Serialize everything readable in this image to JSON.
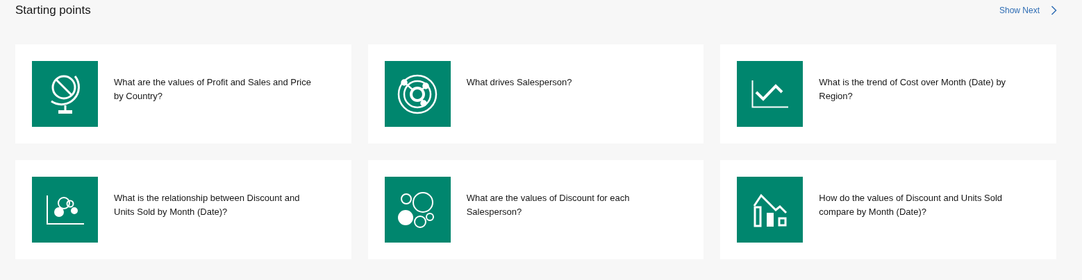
{
  "header": {
    "title": "Starting points",
    "show_next": "Show Next"
  },
  "cards": [
    {
      "kind": "globe",
      "question": "What are the values of Profit and Sales and Price by Country?"
    },
    {
      "kind": "network",
      "question": "What drives Salesperson?"
    },
    {
      "kind": "line",
      "question": "What is the trend of Cost over Month (Date) by Region?"
    },
    {
      "kind": "scatter",
      "question": "What is the relationship between Discount and Units Sold by Month (Date)?"
    },
    {
      "kind": "bubbles",
      "question": "What are the values of Discount for each Salesperson?"
    },
    {
      "kind": "combo",
      "question": "How do the values of Discount and Units Sold compare by Month (Date)?"
    }
  ]
}
